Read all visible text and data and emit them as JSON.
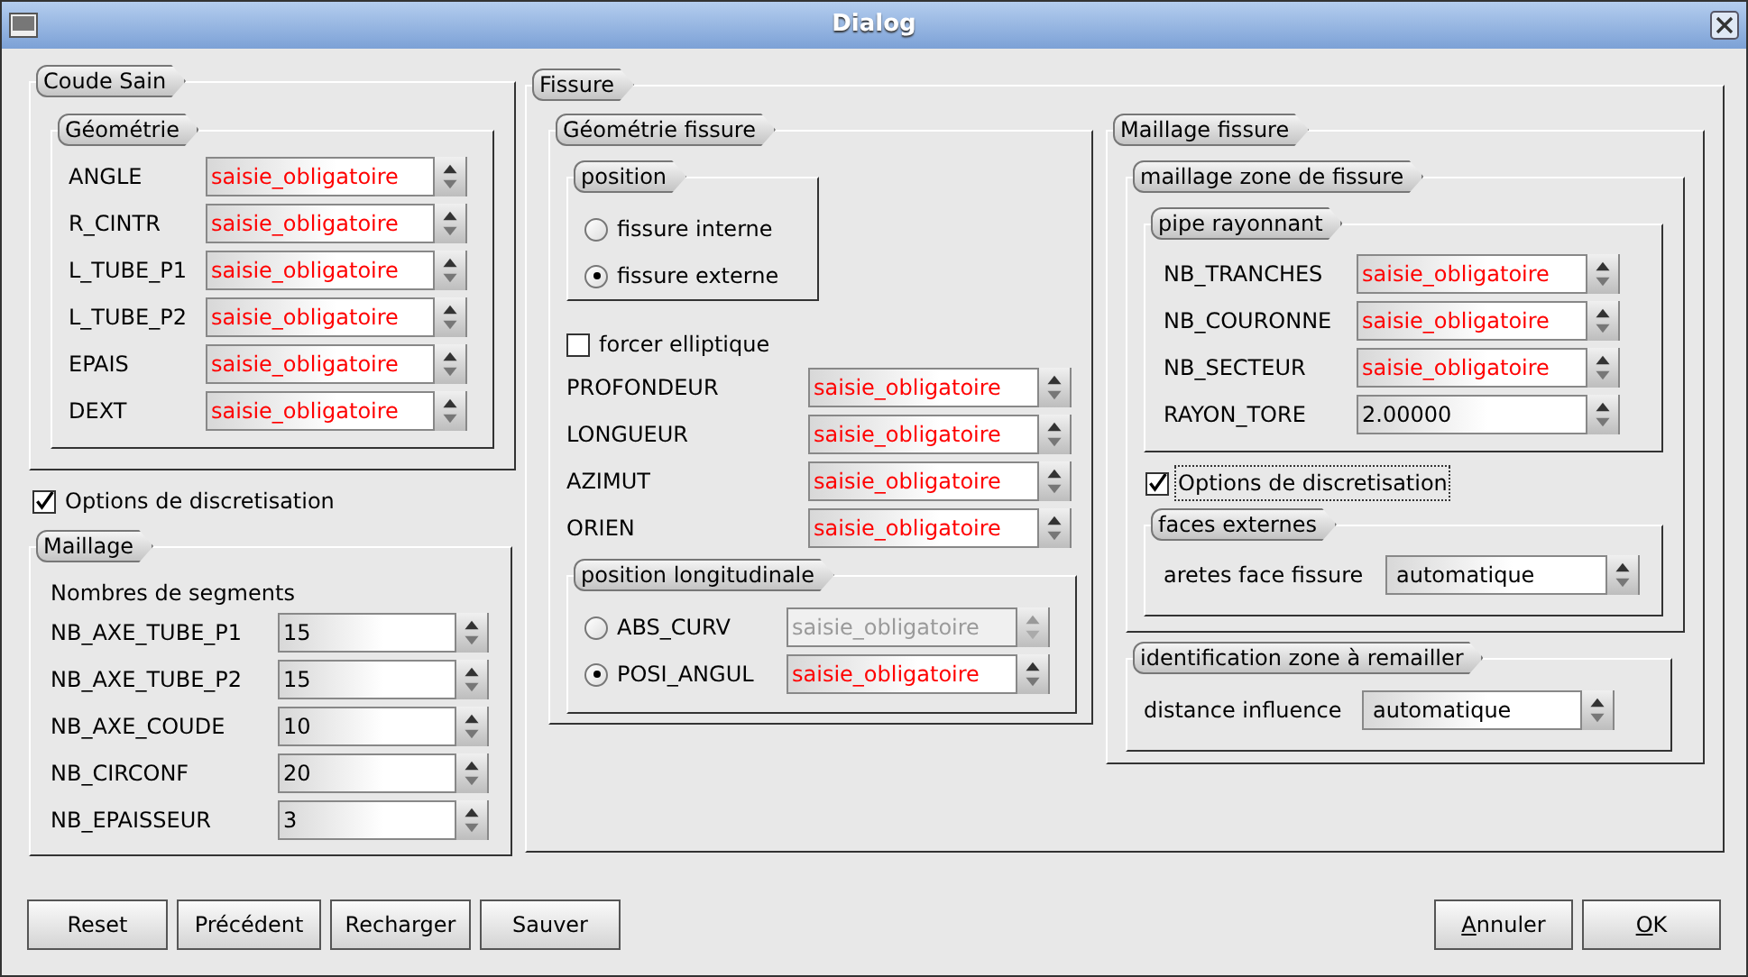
{
  "window": {
    "title": "Dialog"
  },
  "coude_sain": {
    "title": "Coude Sain",
    "geometrie": {
      "title": "Géométrie",
      "fields": [
        {
          "label": "ANGLE",
          "value": "saisie_obligatoire",
          "invalid": true
        },
        {
          "label": "R_CINTR",
          "value": "saisie_obligatoire",
          "invalid": true
        },
        {
          "label": "L_TUBE_P1",
          "value": "saisie_obligatoire",
          "invalid": true
        },
        {
          "label": "L_TUBE_P2",
          "value": "saisie_obligatoire",
          "invalid": true
        },
        {
          "label": "EPAIS",
          "value": "saisie_obligatoire",
          "invalid": true
        },
        {
          "label": "DEXT",
          "value": "saisie_obligatoire",
          "invalid": true
        }
      ]
    }
  },
  "options_discretisation": {
    "label": "Options de discretisation",
    "checked": true
  },
  "maillage": {
    "title": "Maillage",
    "subtitle": "Nombres de segments",
    "fields": [
      {
        "label": "NB_AXE_TUBE_P1",
        "value": "15",
        "invalid": false
      },
      {
        "label": "NB_AXE_TUBE_P2",
        "value": "15",
        "invalid": false
      },
      {
        "label": "NB_AXE_COUDE",
        "value": "10",
        "invalid": false
      },
      {
        "label": "NB_CIRCONF",
        "value": "20",
        "invalid": false
      },
      {
        "label": "NB_EPAISSEUR",
        "value": "3",
        "invalid": false
      }
    ]
  },
  "fissure": {
    "title": "Fissure",
    "geometrie_fissure": {
      "title": "Géométrie fissure",
      "position": {
        "title": "position",
        "options": [
          {
            "label": "fissure interne",
            "selected": false
          },
          {
            "label": "fissure externe",
            "selected": true
          }
        ]
      },
      "forcer_elliptique": {
        "label": "forcer elliptique",
        "checked": false
      },
      "fields": [
        {
          "label": "PROFONDEUR",
          "value": "saisie_obligatoire",
          "invalid": true
        },
        {
          "label": "LONGUEUR",
          "value": "saisie_obligatoire",
          "invalid": true
        },
        {
          "label": "AZIMUT",
          "value": "saisie_obligatoire",
          "invalid": true
        },
        {
          "label": "ORIEN",
          "value": "saisie_obligatoire",
          "invalid": true
        }
      ],
      "position_longitudinale": {
        "title": "position longitudinale",
        "options": [
          {
            "label": "ABS_CURV",
            "selected": false,
            "value": "saisie_obligatoire",
            "disabled": true
          },
          {
            "label": "POSI_ANGUL",
            "selected": true,
            "value": "saisie_obligatoire",
            "invalid": true,
            "disabled": false
          }
        ]
      }
    },
    "maillage_fissure": {
      "title": "Maillage fissure",
      "zone": {
        "title": "maillage zone de fissure",
        "pipe": {
          "title": "pipe rayonnant",
          "fields": [
            {
              "label": "NB_TRANCHES",
              "value": "saisie_obligatoire",
              "invalid": true
            },
            {
              "label": "NB_COURONNE",
              "value": "saisie_obligatoire",
              "invalid": true
            },
            {
              "label": "NB_SECTEUR",
              "value": "saisie_obligatoire",
              "invalid": true
            },
            {
              "label": "RAYON_TORE",
              "value": "2.00000",
              "invalid": false
            }
          ]
        },
        "options": {
          "label": "Options de discretisation",
          "checked": true,
          "focused": true
        },
        "faces_externes": {
          "title": "faces externes",
          "label": "aretes face fissure",
          "value": "automatique"
        }
      },
      "identification": {
        "title": "identification zone à remailler",
        "label": "distance influence",
        "value": "automatique"
      }
    }
  },
  "buttons_left": [
    {
      "label": "Reset",
      "mnemonic": false
    },
    {
      "label": "Précédent",
      "mnemonic": false
    },
    {
      "label": "Recharger",
      "mnemonic": false
    },
    {
      "label": "Sauver",
      "mnemonic": false
    }
  ],
  "buttons_right": [
    {
      "label": "Annuler",
      "mnemonic": true
    },
    {
      "label": "OK",
      "mnemonic": true
    }
  ]
}
